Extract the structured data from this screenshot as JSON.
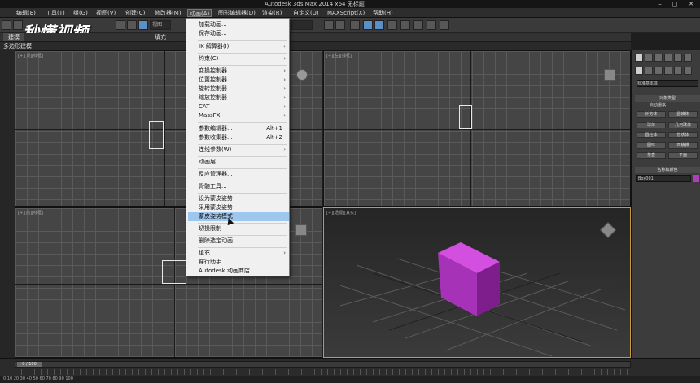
{
  "titlebar": {
    "title": "Autodesk 3ds Max  2014 x64      无标题"
  },
  "menubar": {
    "items": [
      {
        "label": "编辑(E)"
      },
      {
        "label": "工具(T)"
      },
      {
        "label": "组(G)"
      },
      {
        "label": "视图(V)"
      },
      {
        "label": "创建(C)"
      },
      {
        "label": "修改器(M)"
      },
      {
        "label": "动画(A)"
      },
      {
        "label": "图形编辑器(D)"
      },
      {
        "label": "渲染(R)"
      },
      {
        "label": "自定义(U)"
      },
      {
        "label": "MAXScript(X)"
      },
      {
        "label": "帮助(H)"
      }
    ]
  },
  "toolbar": {
    "view_dropdown": "视图"
  },
  "ribbon": {
    "tabs": [
      {
        "label": "建模"
      },
      {
        "label": "填充"
      }
    ]
  },
  "subbar": {
    "label": "多边形建模"
  },
  "viewports": {
    "top_left": "[+][顶][线框]",
    "top_right": "[+][左][线框]",
    "bottom_left": "[+][前][线框]",
    "bottom_right": "[+][透视][真实]"
  },
  "dropdown": {
    "items": [
      {
        "label": "加载动画..."
      },
      {
        "label": "保存动画..."
      },
      {
        "label": "IK 解算器(I)",
        "submenu": true
      },
      {
        "label": "约束(C)",
        "submenu": true
      },
      {
        "label": "变换控制器",
        "submenu": true
      },
      {
        "label": "位置控制器",
        "submenu": true
      },
      {
        "label": "旋转控制器",
        "submenu": true
      },
      {
        "label": "缩放控制器",
        "submenu": true
      },
      {
        "label": "CAT",
        "submenu": true
      },
      {
        "label": "MassFX",
        "submenu": true
      },
      {
        "label": "参数编辑器...",
        "shortcut": "Alt+1"
      },
      {
        "label": "参数收集器...",
        "shortcut": "Alt+2"
      },
      {
        "label": "连线参数(W)",
        "submenu": true
      },
      {
        "label": "动画层..."
      },
      {
        "label": "反应管理器..."
      },
      {
        "label": "骨骼工具..."
      },
      {
        "label": "设为蒙皮姿势"
      },
      {
        "label": "采用蒙皮姿势"
      },
      {
        "label": "蒙皮姿势模式"
      },
      {
        "label": "切换限制"
      },
      {
        "label": "删除选定动画"
      },
      {
        "label": "填充",
        "submenu": true
      },
      {
        "label": "穿行助手..."
      },
      {
        "label": "Autodesk 动画商店..."
      }
    ]
  },
  "right_panel": {
    "dropdown": "标准基本体",
    "object_type_title": "对象类型",
    "autogrid": "自动栅格",
    "buttons": [
      "长方体",
      "圆锥体",
      "球体",
      "几何球体",
      "圆柱体",
      "管状体",
      "圆环",
      "四棱锥",
      "茶壶",
      "平面"
    ],
    "name_color_title": "名称和颜色",
    "object_name": "Box001",
    "object_color": "#b03cc0"
  },
  "timeline": {
    "frame": "0 / 100"
  },
  "status": {
    "text": "0  10  20  30  40  50  60  70  80  90  100"
  },
  "watermark": {
    "text": "秒懂视频"
  }
}
